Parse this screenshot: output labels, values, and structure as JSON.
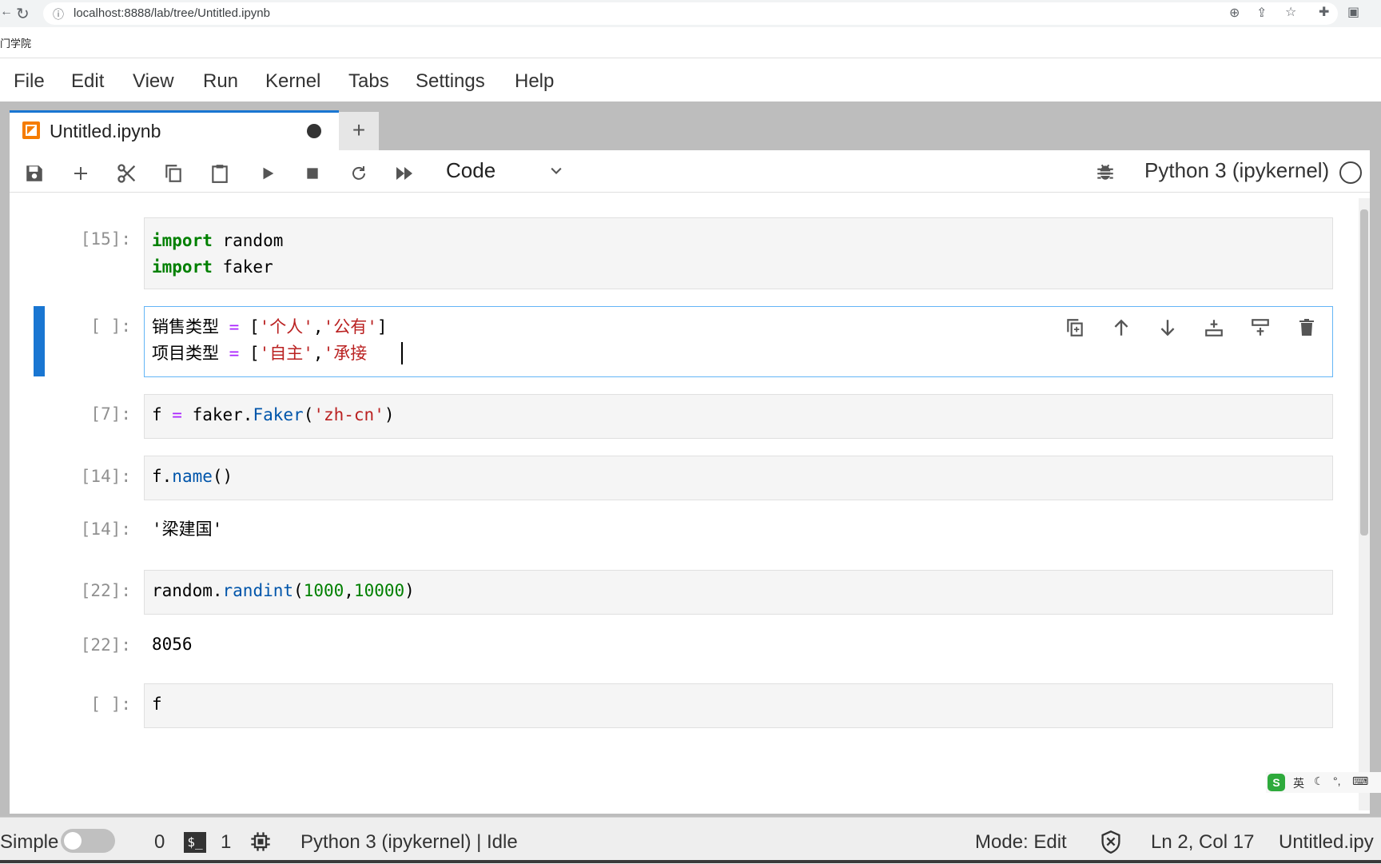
{
  "browser": {
    "url": "localhost:8888/lab/tree/Untitled.ipynb",
    "bookmark_text": "门学院"
  },
  "menu": [
    "File",
    "Edit",
    "View",
    "Run",
    "Kernel",
    "Tabs",
    "Settings",
    "Help"
  ],
  "tab": {
    "title": "Untitled.ipynb",
    "new_tab_symbol": "+"
  },
  "toolbar": {
    "cell_type": "Code",
    "kernel": "Python 3 (ipykernel)"
  },
  "cells": [
    {
      "prompt": "[15]:",
      "lines": [
        "import random",
        "import faker"
      ]
    },
    {
      "prompt": "[ ]:",
      "lines": [
        "销售类型 = ['个人','公有']",
        "项目类型 = ['自主','承接"
      ]
    },
    {
      "prompt": "[7]:",
      "lines": [
        "f = faker.Faker('zh-cn')"
      ]
    },
    {
      "prompt": "[14]:",
      "lines": [
        "f.name()"
      ],
      "output_prompt": "[14]:",
      "output": "'梁建国'"
    },
    {
      "prompt": "[22]:",
      "lines": [
        "random.randint(1000,10000)"
      ],
      "output_prompt": "[22]:",
      "output": "8056"
    },
    {
      "prompt": "[ ]:",
      "lines": [
        "f"
      ]
    }
  ],
  "ime": {
    "label": "英"
  },
  "statusbar": {
    "simple_label": "Simple",
    "simple_mode_on": false,
    "terminals_count": "0",
    "kernels_count": "1",
    "kernel_status": "Python 3 (ipykernel) | Idle",
    "mode": "Mode: Edit",
    "cursor_position": "Ln 2, Col 17",
    "filename": "Untitled.ipy"
  },
  "colors": {
    "accent": "#1976d2",
    "keyword": "#008000",
    "string": "#ba2121",
    "operator": "#aa22ff",
    "function": "#0055aa"
  },
  "icons": [
    "info-icon",
    "reload-icon",
    "zoom-icon",
    "share-icon",
    "star-icon",
    "extensions-icon",
    "sidepanel-icon",
    "save-icon",
    "add-cell-icon",
    "cut-icon",
    "copy-icon",
    "paste-icon",
    "run-icon",
    "stop-icon",
    "restart-icon",
    "run-all-icon",
    "chevron-down-icon",
    "bug-icon",
    "duplicate-icon",
    "move-up-icon",
    "move-down-icon",
    "insert-above-icon",
    "insert-below-icon",
    "delete-icon",
    "terminal-icon",
    "kernel-chip-icon",
    "shield-icon"
  ]
}
